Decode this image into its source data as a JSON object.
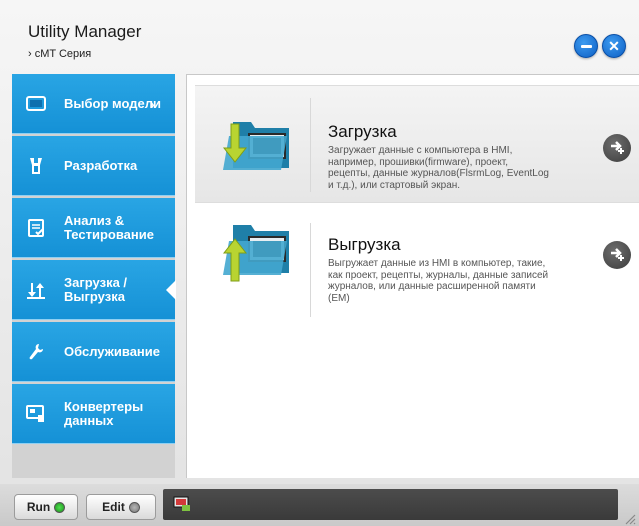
{
  "window": {
    "title": "Utility Manager",
    "subtitle": "› cMT Серия",
    "minimize_icon": "minimize-icon",
    "close_icon": "close-icon",
    "close_glyph": "✕"
  },
  "sidebar": {
    "items": [
      {
        "label": "Выбор модели",
        "icon": "monitor-icon",
        "chevron": "›",
        "active": false
      },
      {
        "label": "Разработка",
        "icon": "tools-icon",
        "active": false
      },
      {
        "label": "Анализ & Тестирование",
        "icon": "checklist-icon",
        "active": false
      },
      {
        "label": "Загрузка / Выгрузка",
        "icon": "transfer-icon",
        "active": true
      },
      {
        "label": "Обслуживание",
        "icon": "wrench-icon",
        "active": false
      },
      {
        "label": "Конвертеры данных",
        "icon": "converter-icon",
        "active": false
      }
    ]
  },
  "main": {
    "cards": [
      {
        "title": "Загрузка",
        "description": "Загружает данные с компьютера в HMI, например, прошивки(firmware), проект, рецепты, данные журналов(FlsrmLog, EventLog и т.д.), или стартовый экран.",
        "icon": "download-folder-icon",
        "highlighted": true
      },
      {
        "title": "Выгрузка",
        "description": "Выгружает данные из HMI в компьютер, такие, как проект, рецепты, журналы, данные записей журналов, или данные расширенной памяти (EM)",
        "icon": "upload-folder-icon",
        "highlighted": false
      }
    ],
    "go_icon": "add-arrow-icon"
  },
  "footer": {
    "run_label": "Run",
    "edit_label": "Edit",
    "status_icon": "hmi-status-icon"
  },
  "colors": {
    "accent": "#1a9ad9",
    "window_button": "#1565c0",
    "footer_bar": "#424242"
  }
}
